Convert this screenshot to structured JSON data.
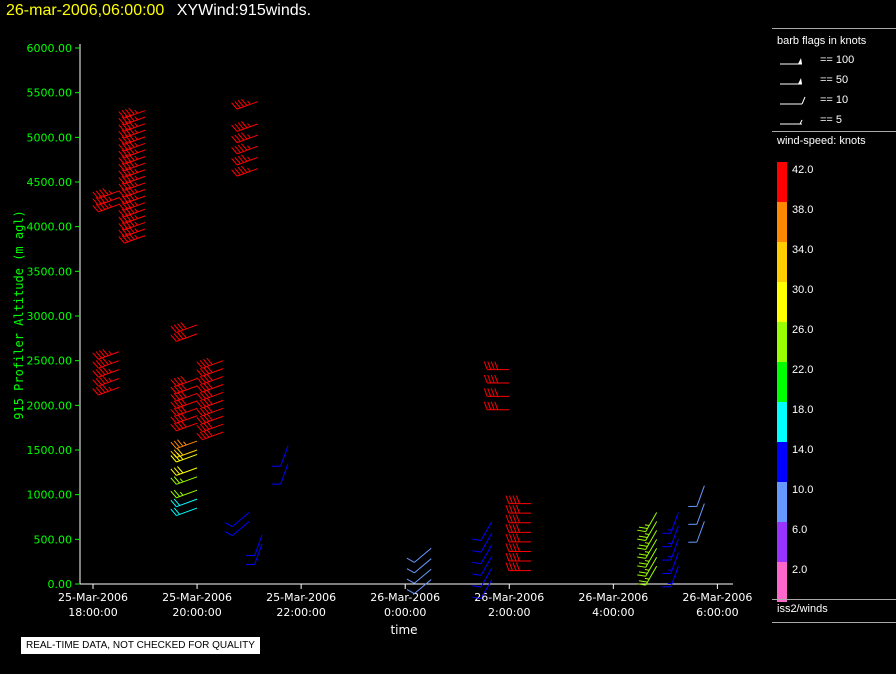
{
  "header": {
    "date": "26-mar-2006,06:00:00",
    "title": "XYWind:915winds."
  },
  "legend": {
    "title": "barb flags in knots",
    "flags": [
      {
        "label": "== 100",
        "kind": "flag"
      },
      {
        "label": "== 50",
        "kind": "flag"
      },
      {
        "label": "== 10",
        "kind": "full"
      },
      {
        "label": "== 5",
        "kind": "half"
      }
    ],
    "colorbar_title": "wind-speed: knots",
    "colorbar": {
      "colors": [
        "#ff66cc",
        "#9933ff",
        "#6699ff",
        "#0000ff",
        "#00ffff",
        "#00ff00",
        "#99ff00",
        "#ffff00",
        "#ffcc00",
        "#ff8800",
        "#ff0000"
      ],
      "labels": [
        "2.0",
        "6.0",
        "10.0",
        "14.0",
        "18.0",
        "22.0",
        "26.0",
        "30.0",
        "34.0",
        "38.0",
        "42.0"
      ]
    },
    "source": "iss2/winds"
  },
  "qc_notice": "REAL-TIME DATA, NOT CHECKED FOR QUALITY",
  "chart_data": {
    "type": "scatter",
    "subtype": "wind-barb time-height",
    "ylabel": "915 Profiler Altitude (m agl)",
    "xlabel": "time",
    "ylim": [
      0,
      6000
    ],
    "xlim_hours": [
      17.75,
      6.3
    ],
    "yticks": [
      "0.00",
      "500.00",
      "1000.00",
      "1500.00",
      "2000.00",
      "2500.00",
      "3000.00",
      "3500.00",
      "4000.00",
      "4500.00",
      "5000.00",
      "5500.00",
      "6000.00"
    ],
    "xticks": [
      {
        "date": "25-Mar-2006",
        "time": "18:00:00"
      },
      {
        "date": "25-Mar-2006",
        "time": "20:00:00"
      },
      {
        "date": "25-Mar-2006",
        "time": "22:00:00"
      },
      {
        "date": "26-Mar-2006",
        "time": "0:00:00"
      },
      {
        "date": "26-Mar-2006",
        "time": "2:00:00"
      },
      {
        "date": "26-Mar-2006",
        "time": "4:00:00"
      },
      {
        "date": "26-Mar-2006",
        "time": "6:00:00"
      }
    ],
    "profiles": [
      {
        "time": "25-Mar-2006 18:30",
        "alt_start": 2200,
        "alt_end": 2600,
        "count": 5,
        "speed": 44,
        "dir": 250
      },
      {
        "time": "25-Mar-2006 18:30",
        "alt_start": 4250,
        "alt_end": 4400,
        "count": 3,
        "speed": 44,
        "dir": 250
      },
      {
        "time": "25-Mar-2006 19:00",
        "alt_start": 3900,
        "alt_end": 5300,
        "count": 20,
        "speed": 45,
        "dir": 250
      },
      {
        "time": "25-Mar-2006 20:00",
        "alt_start": 2800,
        "alt_end": 2900,
        "count": 2,
        "speed": 42,
        "dir": 250
      },
      {
        "time": "25-Mar-2006 20:00",
        "alt_start": 1800,
        "alt_end": 2300,
        "count": 7,
        "speed": 42,
        "dir": 250
      },
      {
        "time": "25-Mar-2006 20:00",
        "alt_start": 1600,
        "alt_end": 1650,
        "count": 1,
        "speed": 36,
        "dir": 250
      },
      {
        "time": "25-Mar-2006 20:00",
        "alt_start": 1500,
        "alt_end": 1550,
        "count": 1,
        "speed": 32,
        "dir": 250
      },
      {
        "time": "25-Mar-2006 20:00",
        "alt_start": 1300,
        "alt_end": 1450,
        "count": 2,
        "speed": 28,
        "dir": 250
      },
      {
        "time": "25-Mar-2006 20:00",
        "alt_start": 1050,
        "alt_end": 1200,
        "count": 2,
        "speed": 24,
        "dir": 250
      },
      {
        "time": "25-Mar-2006 20:00",
        "alt_start": 850,
        "alt_end": 950,
        "count": 2,
        "speed": 19,
        "dir": 250
      },
      {
        "time": "25-Mar-2006 20:30",
        "alt_start": 1700,
        "alt_end": 2500,
        "count": 10,
        "speed": 42,
        "dir": 250
      },
      {
        "time": "25-Mar-2006 21:00",
        "alt_start": 700,
        "alt_end": 800,
        "count": 2,
        "speed": 12,
        "dir": 230
      },
      {
        "time": "25-Mar-2006 21:15",
        "alt_start": 450,
        "alt_end": 550,
        "count": 2,
        "speed": 12,
        "dir": 200
      },
      {
        "time": "25-Mar-2006 21:10",
        "alt_start": 4650,
        "alt_end": 5150,
        "count": 5,
        "speed": 45,
        "dir": 250
      },
      {
        "time": "25-Mar-2006 21:10",
        "alt_start": 5400,
        "alt_end": 5450,
        "count": 1,
        "speed": 45,
        "dir": 250
      },
      {
        "time": "25-Mar-2006 21:45",
        "alt_start": 1350,
        "alt_end": 1550,
        "count": 2,
        "speed": 12,
        "dir": 200
      },
      {
        "time": "26-Mar-2006 0:30",
        "alt_start": 50,
        "alt_end": 400,
        "count": 4,
        "speed": 8,
        "dir": 230
      },
      {
        "time": "26-Mar-2006 1:40",
        "alt_start": 50,
        "alt_end": 700,
        "count": 6,
        "speed": 12,
        "dir": 210
      },
      {
        "time": "26-Mar-2006 2:00",
        "alt_start": 1950,
        "alt_end": 2400,
        "count": 4,
        "speed": 42,
        "dir": 270
      },
      {
        "time": "26-Mar-2006 2:25",
        "alt_start": 150,
        "alt_end": 900,
        "count": 8,
        "speed": 42,
        "dir": 270
      },
      {
        "time": "26-Mar-2006 4:50",
        "alt_start": 200,
        "alt_end": 800,
        "count": 7,
        "speed": 24,
        "dir": 210
      },
      {
        "time": "26-Mar-2006 5:15",
        "alt_start": 200,
        "alt_end": 800,
        "count": 5,
        "speed": 14,
        "dir": 200
      },
      {
        "time": "26-Mar-2006 5:45",
        "alt_start": 700,
        "alt_end": 1100,
        "count": 3,
        "speed": 9,
        "dir": 200
      }
    ]
  }
}
